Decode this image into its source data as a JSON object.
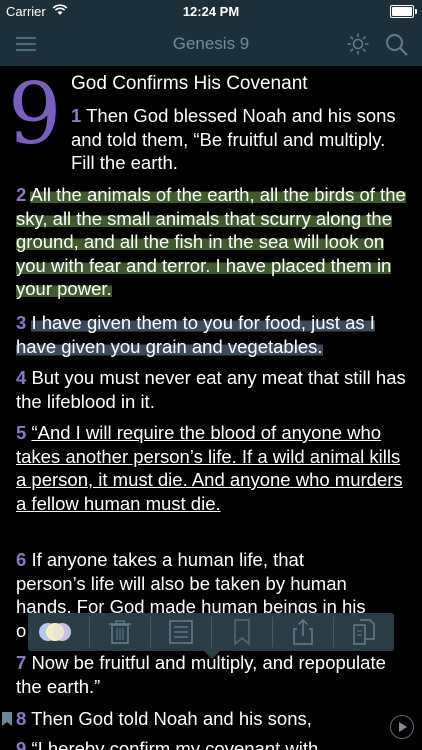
{
  "status": {
    "carrier": "Carrier",
    "time": "12:24 PM"
  },
  "nav": {
    "title": "Genesis 9"
  },
  "chapter": {
    "number": "9",
    "heading": "God Confirms His Covenant"
  },
  "verses": [
    {
      "num": "1",
      "text": "Then God blessed Noah and his sons and told them, “Be fruitful and multiply. Fill the earth."
    },
    {
      "num": "2",
      "text": "All the animals of the earth, all the birds of the sky, all the small animals that scurry along the ground, and all the fish in the sea will look on you with fear and terror. I have placed them in your power."
    },
    {
      "num": "3",
      "text": "I have given them to you for food, just as I have given you grain and vegetables."
    },
    {
      "num": "4",
      "text": "But you must never eat any meat that still has the lifeblood in it."
    },
    {
      "num": "5",
      "text": "“And I will require the blood of anyone who takes another person’s life. If a wild animal kills a person, it must die. And anyone who murders a fellow human must die."
    },
    {
      "num": "6",
      "text_line1": "If anyone takes a human life, that",
      "text_line2": "person’s life will also be taken by human",
      "text_line3": "hands. For God made human beings in his",
      "text_line4": "o"
    },
    {
      "num": "7",
      "text": "Now be fruitful and multiply, and repopulate the earth.”"
    },
    {
      "num": "8",
      "text": "Then God told Noah and his sons,"
    },
    {
      "num": "9",
      "text": "“I hereby confirm my covenant with"
    }
  ],
  "colors": {
    "accent": "#7a5fc0",
    "highlight_green": "#3f5a2c",
    "highlight_blue": "#3d4a5c",
    "bar": "#1d2f38"
  },
  "toolbar_icons": [
    "color-palette-icon",
    "trash-icon",
    "note-icon",
    "bookmark-icon",
    "share-icon",
    "copy-icon"
  ]
}
